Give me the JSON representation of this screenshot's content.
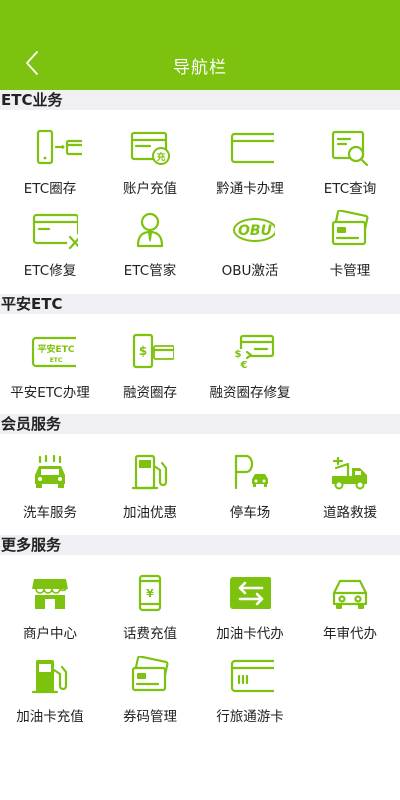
{
  "header": {
    "title": "导航栏"
  },
  "colors": {
    "accent": "#7cc20e",
    "section_bg": "#efeff4"
  },
  "sections": {
    "etc": {
      "title": "ETC业务",
      "items": [
        {
          "label": "ETC圈存",
          "icon": "phone-card-icon"
        },
        {
          "label": "账户充值",
          "icon": "card-recharge-icon"
        },
        {
          "label": "黔通卡办理",
          "icon": "card-icon"
        },
        {
          "label": "ETC查询",
          "icon": "card-search-icon"
        },
        {
          "label": "ETC修复",
          "icon": "card-repair-icon"
        },
        {
          "label": "ETC管家",
          "icon": "butler-icon"
        },
        {
          "label": "OBU激活",
          "icon": "obu-icon"
        },
        {
          "label": "卡管理",
          "icon": "cards-stack-icon"
        }
      ]
    },
    "pingan": {
      "title": "平安ETC",
      "items": [
        {
          "label": "平安ETC办理",
          "icon": "pingan-etc-card-icon",
          "card_text": "平安ETC",
          "card_sub": "ETC"
        },
        {
          "label": "融资圈存",
          "icon": "finance-card-icon"
        },
        {
          "label": "融资圈存修复",
          "icon": "finance-repair-icon"
        }
      ]
    },
    "member": {
      "title": "会员服务",
      "items": [
        {
          "label": "洗车服务",
          "icon": "car-wash-icon"
        },
        {
          "label": "加油优惠",
          "icon": "fuel-pump-icon"
        },
        {
          "label": "停车场",
          "icon": "parking-icon"
        },
        {
          "label": "道路救援",
          "icon": "tow-truck-icon"
        }
      ]
    },
    "more": {
      "title": "更多服务",
      "items": [
        {
          "label": "商户中心",
          "icon": "shop-icon"
        },
        {
          "label": "话费充值",
          "icon": "phone-recharge-icon"
        },
        {
          "label": "加油卡代办",
          "icon": "transfer-icon"
        },
        {
          "label": "年审代办",
          "icon": "car-icon"
        },
        {
          "label": "加油卡充值",
          "icon": "fuel-card-icon"
        },
        {
          "label": "券码管理",
          "icon": "coupon-icon"
        },
        {
          "label": "行旅通游卡",
          "icon": "travel-card-icon"
        }
      ]
    }
  }
}
